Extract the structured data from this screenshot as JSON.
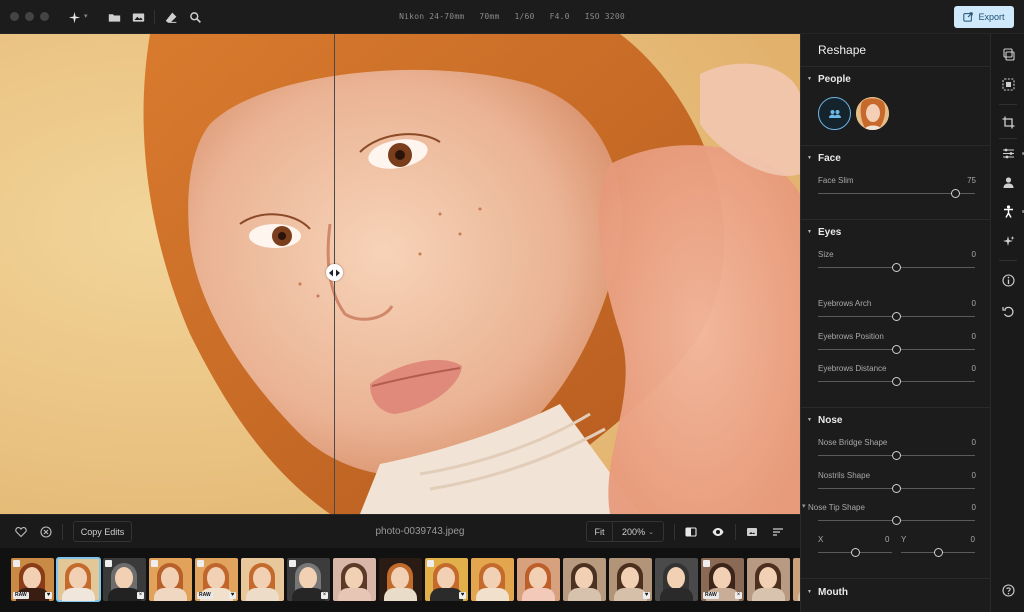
{
  "camera_meta": {
    "lens": "Nikon 24-70mm",
    "focal": "70mm",
    "shutter": "1/60",
    "aperture": "F4.0",
    "iso": "ISO 3200"
  },
  "toolbar": {
    "export_label": "Export",
    "icons": [
      "ai-sparkle-icon",
      "folder-icon",
      "image-icon",
      "eraser-icon",
      "magnifier-icon"
    ]
  },
  "bottom_bar": {
    "copy_edits_label": "Copy Edits",
    "filename": "photo-0039743.jpeg",
    "fit_label": "Fit",
    "zoom_label": "200%",
    "zoom_caret": "⌄"
  },
  "panel": {
    "title": "Reshape",
    "sections": {
      "people": {
        "label": "People"
      },
      "face": {
        "label": "Face",
        "sliders": [
          {
            "label": "Face Slim",
            "value": "75",
            "level": 75,
            "min": -100,
            "max": 100
          }
        ]
      },
      "eyes": {
        "label": "Eyes",
        "sliders": [
          {
            "label": "Size",
            "value": "0",
            "level": 0,
            "min": -100,
            "max": 100
          },
          {
            "label": "Eyebrows Arch",
            "value": "0",
            "level": 0,
            "min": -100,
            "max": 100
          },
          {
            "label": "Eyebrows Position",
            "value": "0",
            "level": 0,
            "min": -100,
            "max": 100
          },
          {
            "label": "Eyebrows Distance",
            "value": "0",
            "level": 0,
            "min": -100,
            "max": 100
          }
        ]
      },
      "nose": {
        "label": "Nose",
        "sliders": [
          {
            "label": "Nose Bridge Shape",
            "value": "0",
            "level": 0,
            "min": -100,
            "max": 100
          },
          {
            "label": "Nostrils Shape",
            "value": "0",
            "level": 0,
            "min": -100,
            "max": 100
          },
          {
            "label": "Nose Tip Shape",
            "value": "0",
            "level": 0,
            "min": -100,
            "max": 100
          }
        ],
        "tip_x": {
          "label": "X",
          "value": "0",
          "level": 0,
          "min": -100,
          "max": 100
        },
        "tip_y": {
          "label": "Y",
          "value": "0",
          "level": 0,
          "min": -100,
          "max": 100
        }
      },
      "mouth": {
        "label": "Mouth"
      }
    }
  },
  "rail_icons": [
    "layers-icon",
    "select-icon",
    "crop-icon",
    "adjust-icon",
    "portrait-icon",
    "reshape-icon",
    "ai-enhance-icon",
    "info-icon",
    "history-icon",
    "help-icon"
  ],
  "filmstrip": {
    "thumbnails": [
      {
        "raw": true,
        "edited": true,
        "mark": "heart",
        "bg": "#c98a45",
        "hair": "#8a3c18",
        "body": "#3a1d12"
      },
      {
        "raw": false,
        "edited": false,
        "mark": "",
        "bg": "#e4c796",
        "hair": "#c46a2c",
        "body": "#f1e6dc",
        "selected": true
      },
      {
        "raw": false,
        "edited": true,
        "mark": "x",
        "bg": "#3a3a3a",
        "hair": "#6d6d6d",
        "body": "#222"
      },
      {
        "raw": false,
        "edited": true,
        "mark": "",
        "bg": "#e3a25a",
        "hair": "#b8602a",
        "body": "#f0d7c2"
      },
      {
        "raw": true,
        "edited": true,
        "mark": "heart",
        "bg": "#e0a45e",
        "hair": "#c0662c",
        "body": "#f0e0cc"
      },
      {
        "raw": false,
        "edited": false,
        "mark": "",
        "bg": "#e8c79a",
        "hair": "#c46a2c",
        "body": "#eddcc8"
      },
      {
        "raw": false,
        "edited": true,
        "mark": "x",
        "bg": "#3c3c3c",
        "hair": "#777",
        "body": "#262626"
      },
      {
        "raw": false,
        "edited": false,
        "mark": "",
        "bg": "#d9b6a8",
        "hair": "#5b3a2a",
        "body": "#e7c6b6"
      },
      {
        "raw": false,
        "edited": false,
        "mark": "",
        "bg": "#2a1b14",
        "hair": "#c06a2c",
        "body": "#e9dcc9"
      },
      {
        "raw": false,
        "edited": true,
        "mark": "heart",
        "bg": "#e2b04a",
        "hair": "#c46a2c",
        "body": "#2b2b2b"
      },
      {
        "raw": false,
        "edited": false,
        "mark": "",
        "bg": "#e3a54e",
        "hair": "#c46a2c",
        "body": "#f0e0cc"
      },
      {
        "raw": false,
        "edited": false,
        "mark": "",
        "bg": "#d8a17d",
        "hair": "#bd5f2a",
        "body": "#f3c9b9"
      },
      {
        "raw": false,
        "edited": false,
        "mark": "",
        "bg": "#b89a7f",
        "hair": "#4a3121",
        "body": "#d7c2ad"
      },
      {
        "raw": false,
        "edited": false,
        "mark": "heart",
        "bg": "#b29478",
        "hair": "#4b2f1f",
        "body": "#d6c0aa"
      },
      {
        "raw": false,
        "edited": false,
        "mark": "",
        "bg": "#4a4a4a",
        "hair": "#333",
        "body": "#2a2a2a"
      },
      {
        "raw": true,
        "edited": true,
        "mark": "x",
        "bg": "#8a6a55",
        "hair": "#3b2419",
        "body": "#c9ad96"
      },
      {
        "raw": false,
        "edited": false,
        "mark": "",
        "bg": "#b79a81",
        "hair": "#4b2f1f",
        "body": "#d8c4ae"
      },
      {
        "raw": false,
        "edited": false,
        "mark": "",
        "bg": "#c9a07a",
        "hair": "#5a3522",
        "body": "#d9c5af"
      }
    ]
  },
  "colors": {
    "accent": "#6cb8e8",
    "export_bg": "#cfe9fb",
    "panel_bg": "#1c1c1c",
    "app_bg": "#161616"
  }
}
